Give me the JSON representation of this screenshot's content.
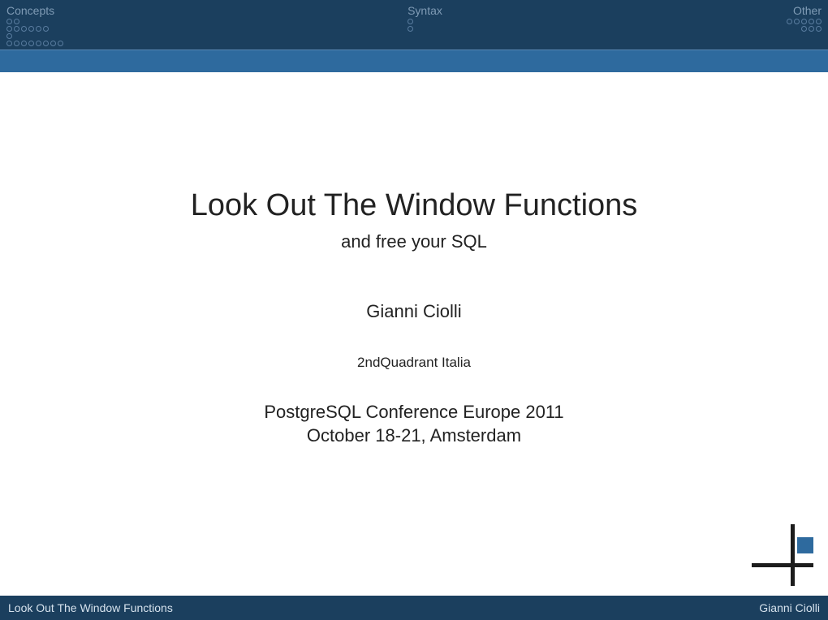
{
  "nav": {
    "sections": [
      {
        "label": "Concepts",
        "align": "left",
        "rows": [
          2,
          6,
          1,
          8
        ]
      },
      {
        "label": "Syntax",
        "align": "center",
        "rows": [
          1,
          1
        ]
      },
      {
        "label": "Other",
        "align": "right",
        "rows": [
          5,
          3
        ]
      }
    ]
  },
  "title": "Look Out The Window Functions",
  "subtitle": "and free your SQL",
  "author": "Gianni Ciolli",
  "affiliation": "2ndQuadrant Italia",
  "conference_line1": "PostgreSQL Conference Europe 2011",
  "conference_line2": "October 18-21, Amsterdam",
  "footer": {
    "left": "Look Out The Window Functions",
    "right": "Gianni Ciolli"
  }
}
